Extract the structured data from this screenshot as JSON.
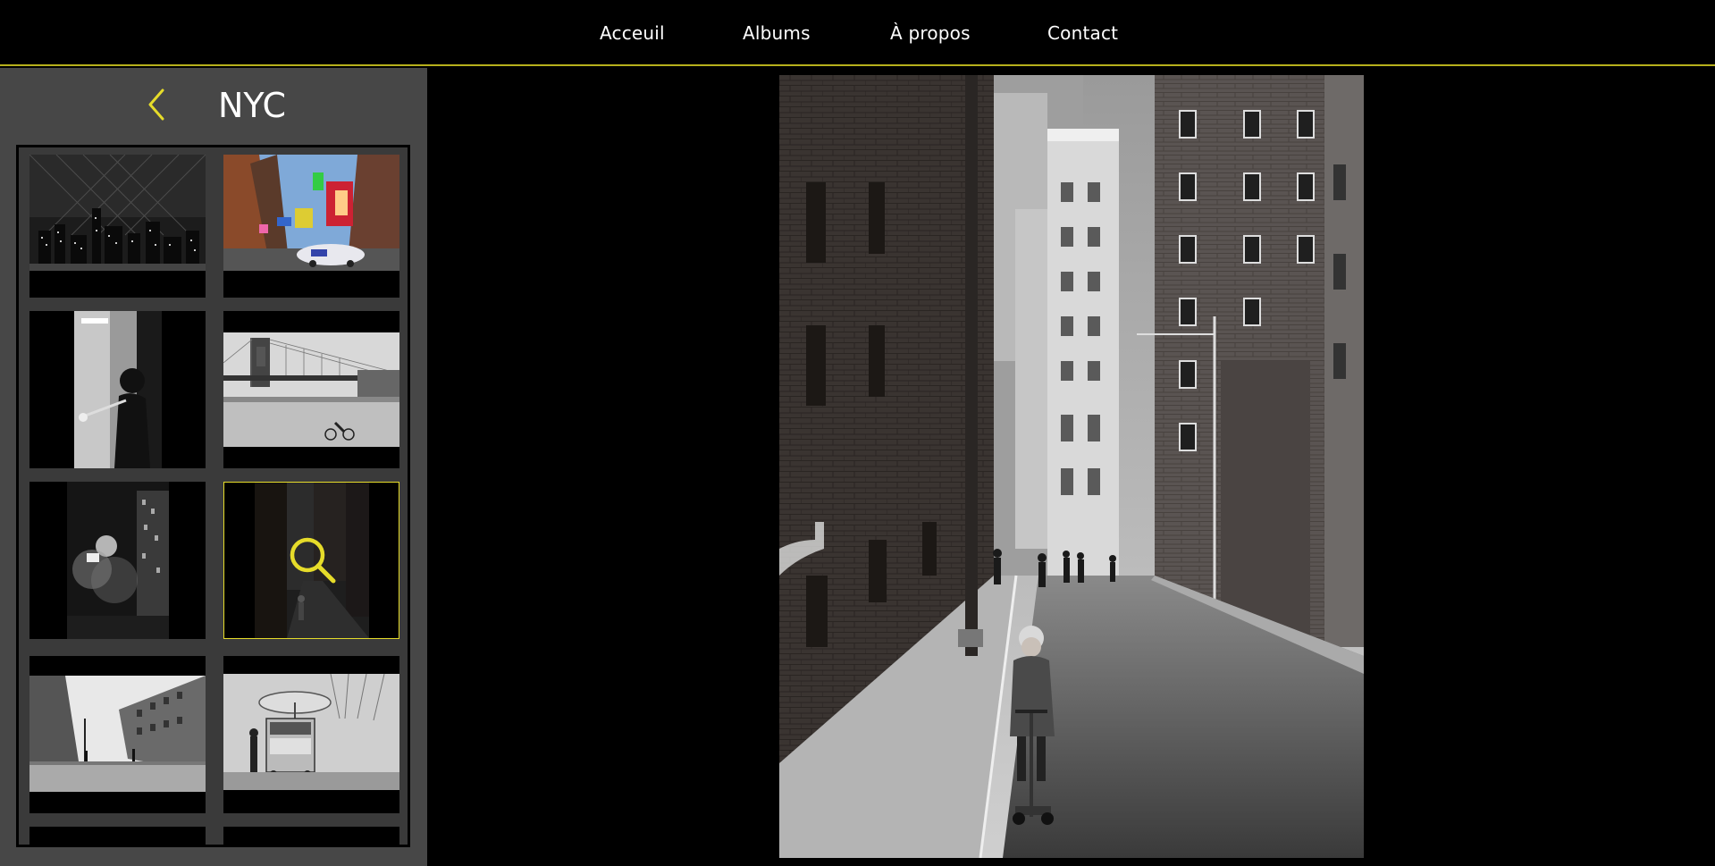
{
  "nav": {
    "items": [
      {
        "label": "Acceuil"
      },
      {
        "label": "Albums"
      },
      {
        "label": "À propos"
      },
      {
        "label": "Contact"
      }
    ],
    "accent_color": "#b7b01c"
  },
  "sidebar": {
    "back_icon": "chevron-left-icon",
    "album_title": "NYC",
    "background": "#474747"
  },
  "gallery": {
    "thumbnails": [
      {
        "subject": "city-skyline-night"
      },
      {
        "subject": "times-square"
      },
      {
        "subject": "trumpet-player"
      },
      {
        "subject": "brooklyn-bridge"
      },
      {
        "subject": "steam-street-night"
      },
      {
        "subject": "alley-child-scooter",
        "selected": true
      },
      {
        "subject": "avenue-street"
      },
      {
        "subject": "hot-dog-cart"
      }
    ],
    "selected_overlay_icon": "magnifier-icon",
    "selected_border_color": "#e6dc2a"
  },
  "viewer": {
    "photo_subject": "child-on-scooter-in-nyc-alley-bw"
  }
}
